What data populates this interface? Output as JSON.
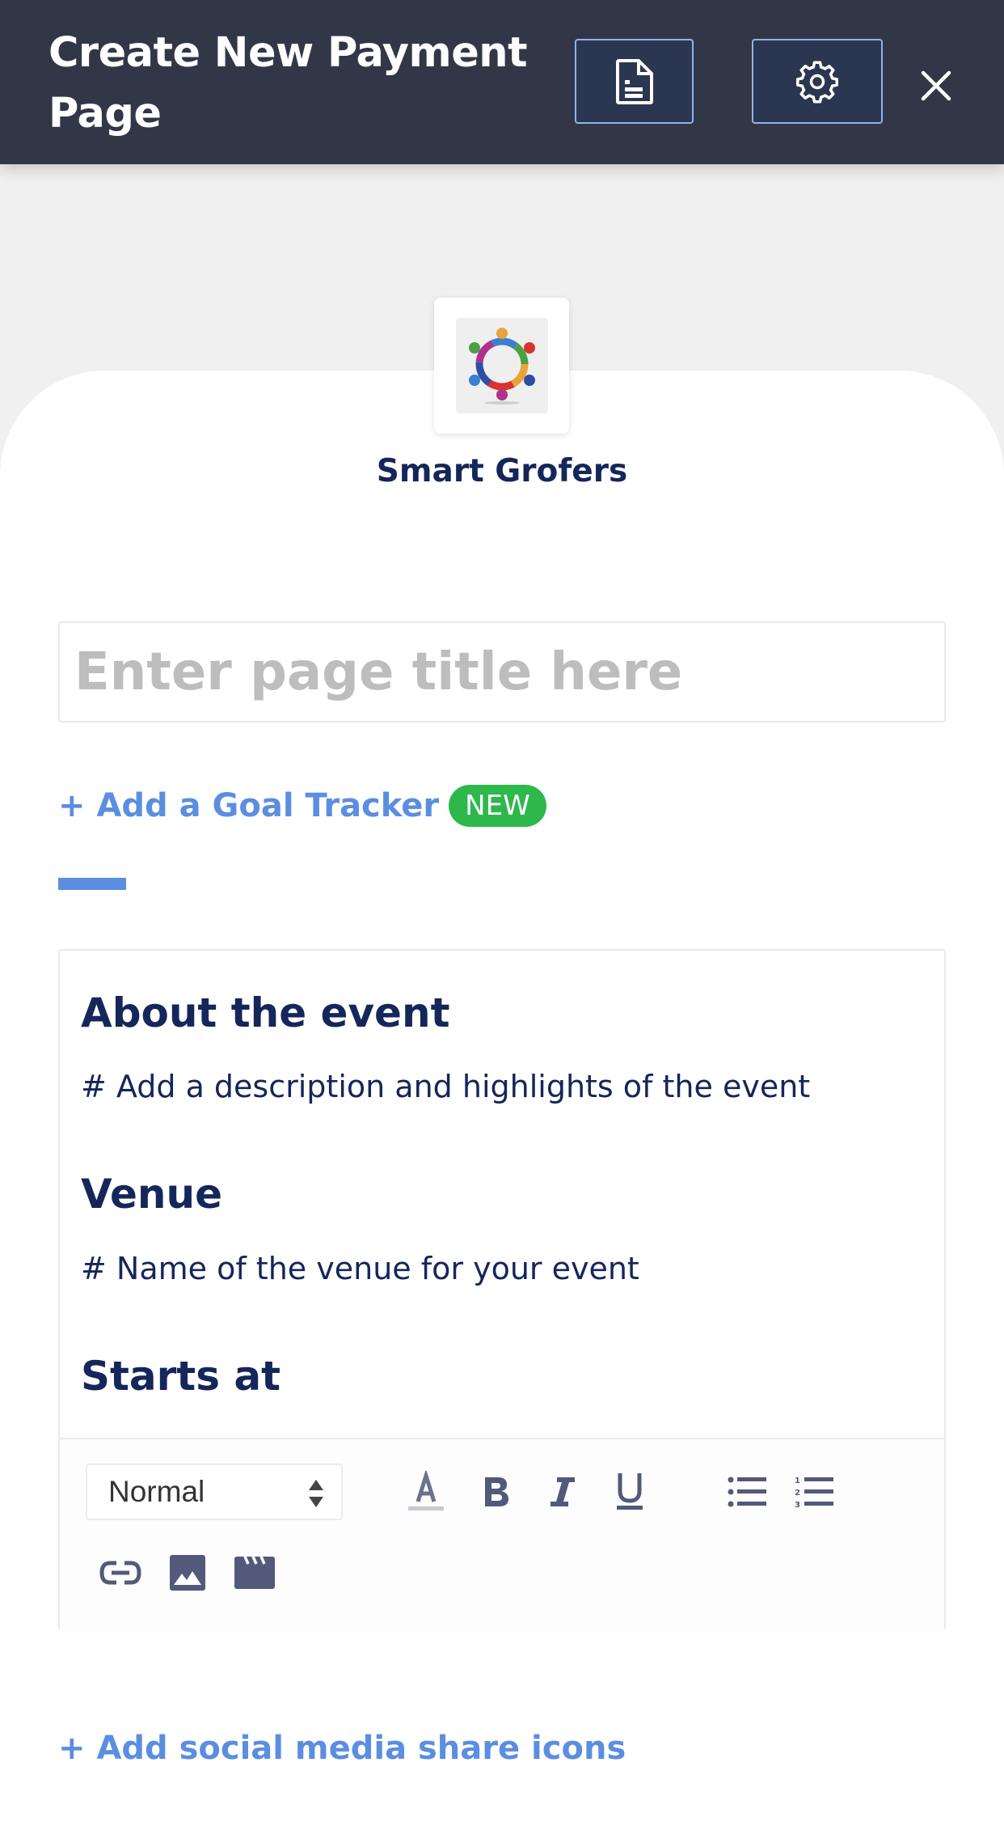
{
  "header": {
    "title": "Create New Payment Page",
    "icons": {
      "preview": "document-icon",
      "settings": "gear-icon",
      "close": "close-icon"
    }
  },
  "merchant": {
    "name": "Smart Grofers",
    "logo": "people-circle-logo"
  },
  "title_input": {
    "value": "",
    "placeholder": "Enter page title here"
  },
  "goal_tracker": {
    "label": "+ Add a Goal Tracker",
    "badge": "NEW"
  },
  "editor": {
    "blocks": [
      {
        "type": "heading",
        "text": "About the event"
      },
      {
        "type": "paragraph",
        "text": "# Add a description and highlights of the event"
      },
      {
        "type": "heading",
        "text": "Venue"
      },
      {
        "type": "paragraph",
        "text": "# Name of the venue for your event"
      },
      {
        "type": "heading",
        "text": "Starts at"
      }
    ],
    "toolbar": {
      "format_select": "Normal",
      "buttons": [
        "text-color-icon",
        "bold-icon",
        "italic-icon",
        "underline-icon",
        "bullet-list-icon",
        "numbered-list-icon",
        "link-icon",
        "image-icon",
        "video-icon"
      ]
    }
  },
  "social_link": {
    "label": "+ Add social media share icons"
  },
  "colors": {
    "header_bg": "#323748",
    "accent": "#5b8ee0",
    "badge": "#2eb84b",
    "text_dark": "#15265a"
  }
}
